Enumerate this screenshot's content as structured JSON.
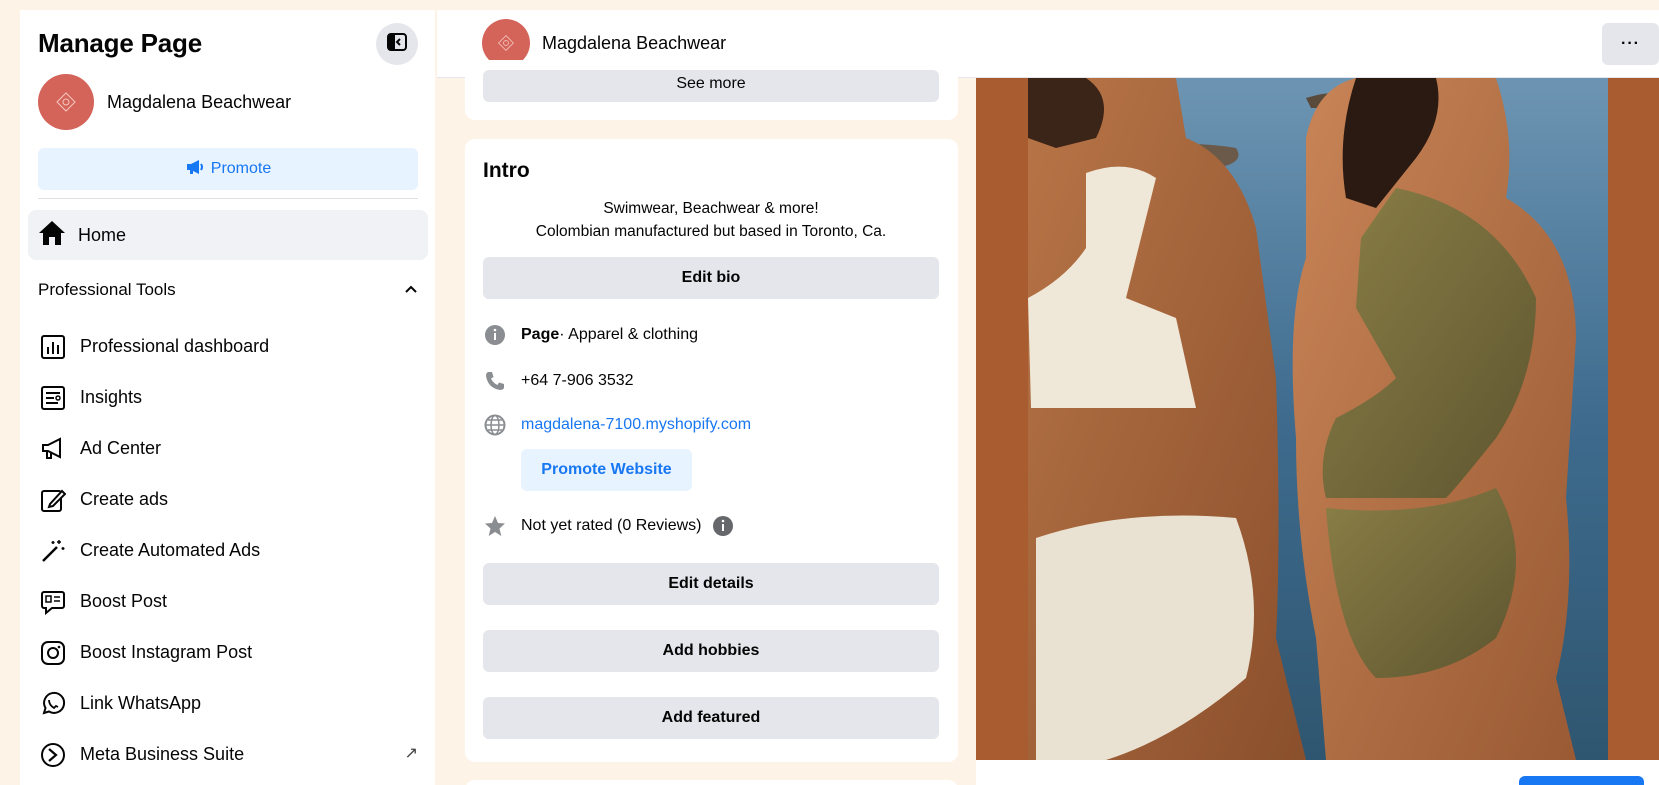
{
  "sidebar": {
    "title": "Manage Page",
    "page_name": "Magdalena Beachwear",
    "promote_label": "Promote",
    "home_label": "Home",
    "section_title": "Professional Tools",
    "items": [
      {
        "label": "Professional dashboard",
        "icon": "dashboard-icon"
      },
      {
        "label": "Insights",
        "icon": "insights-icon"
      },
      {
        "label": "Ad Center",
        "icon": "megaphone-icon"
      },
      {
        "label": "Create ads",
        "icon": "pencil-icon"
      },
      {
        "label": "Create Automated Ads",
        "icon": "magic-wand-icon"
      },
      {
        "label": "Boost Post",
        "icon": "boost-post-icon"
      },
      {
        "label": "Boost Instagram Post",
        "icon": "instagram-icon"
      },
      {
        "label": "Link WhatsApp",
        "icon": "whatsapp-icon"
      },
      {
        "label": "Meta Business Suite",
        "icon": "meta-business-icon",
        "external_icon": "↗"
      }
    ]
  },
  "header": {
    "page_name": "Magdalena Beachwear",
    "more_label": "···"
  },
  "intro": {
    "see_more_label": "See more",
    "title": "Intro",
    "bio_line1": "Swimwear, Beachwear & more!",
    "bio_line2": "Colombian manufactured but based in Toronto, Ca.",
    "edit_bio_label": "Edit bio",
    "category_prefix": "Page",
    "category_text": " · Apparel & clothing",
    "phone": "+64 7-906 3532",
    "website": "magdalena-7100.myshopify.com",
    "promote_website_label": "Promote Website",
    "rating_text": "Not yet rated (0 Reviews)",
    "edit_details_label": "Edit details",
    "add_hobbies_label": "Add hobbies",
    "add_featured_label": "Add featured"
  },
  "colors": {
    "accent": "#1877f2",
    "accent_light": "#e7f3ff",
    "button_gray": "#e4e6eb",
    "avatar": "#d4645a",
    "photo_background": "#a85c30"
  }
}
